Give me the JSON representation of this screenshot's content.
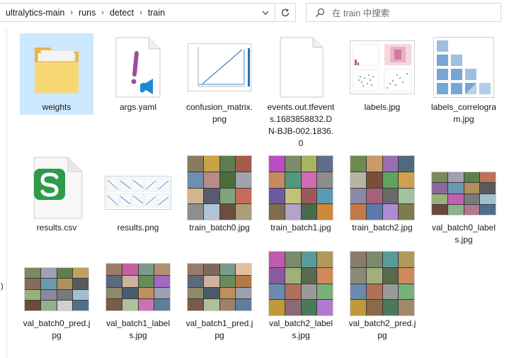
{
  "breadcrumb": [
    "ultralytics-main",
    "runs",
    "detect",
    "train"
  ],
  "search": {
    "placeholder": "在 train 中搜索"
  },
  "left_label": ":)",
  "files": [
    {
      "name": "weights",
      "kind": "folder",
      "selected": true
    },
    {
      "name": "args.yaml",
      "kind": "yaml"
    },
    {
      "name": "confusion_matrix.png",
      "kind": "plot-confusion"
    },
    {
      "name": "events.out.tfevents.1683858832.DN-BJB-002.1836.0",
      "kind": "blank-doc"
    },
    {
      "name": "labels.jpg",
      "kind": "plot-labels"
    },
    {
      "name": "labels_correlogram.jpg",
      "kind": "plot-correlogram"
    },
    {
      "name": "results.csv",
      "kind": "csv"
    },
    {
      "name": "results.png",
      "kind": "plot-results"
    },
    {
      "name": "train_batch0.jpg",
      "kind": "mosaic"
    },
    {
      "name": "train_batch1.jpg",
      "kind": "mosaic"
    },
    {
      "name": "train_batch2.jpg",
      "kind": "mosaic"
    },
    {
      "name": "val_batch0_labels.jpg",
      "kind": "mosaic-wide"
    },
    {
      "name": "val_batch0_pred.jpg",
      "kind": "mosaic-wide"
    },
    {
      "name": "val_batch1_labels.jpg",
      "kind": "mosaic-wide"
    },
    {
      "name": "val_batch1_pred.jpg",
      "kind": "mosaic-wide"
    },
    {
      "name": "val_batch2_labels.jpg",
      "kind": "mosaic"
    },
    {
      "name": "val_batch2_pred.jpg",
      "kind": "mosaic"
    }
  ],
  "colors": {
    "selection": "#cce8ff",
    "folder": "#f8d775",
    "yaml_accent": "#9b4f96",
    "csv_green": "#2e9b4a"
  }
}
